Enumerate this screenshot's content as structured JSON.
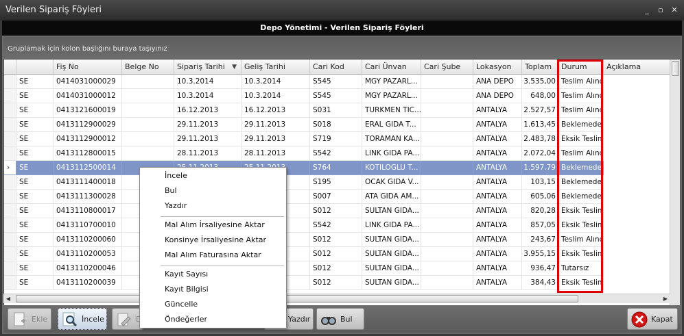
{
  "window": {
    "title": "Verilen Sipariş Föyleri",
    "minimize": "_",
    "maximize": "▫",
    "close": "✕"
  },
  "band_title": "Depo Yönetimi - Verilen Sipariş Föyleri",
  "group_hint": "Gruplamak için kolon başlığını buraya taşıyınız",
  "columns": [
    "",
    "Fiş No",
    "Belge No",
    "Sipariş Tarihi",
    "Geliş Tarihi",
    "Cari Kod",
    "Cari Ünvan",
    "Cari Şube",
    "Lokasyon",
    "Toplam",
    "Durum",
    "Açıklama"
  ],
  "sort_indicator": "▼",
  "rows": [
    {
      "t": "SE",
      "fis": "0414031000029",
      "belge": "",
      "sip": "10.3.2014",
      "gel": "10.3.2014",
      "kod": "S545",
      "unvan": "MGY PAZARL...",
      "sube": "",
      "lok": "ANA DEPO",
      "top": "3.535,00",
      "dur": "Teslim Alındı",
      "acik": ""
    },
    {
      "t": "SE",
      "fis": "0414031000012",
      "belge": "",
      "sip": "10.3.2014",
      "gel": "10.3.2014",
      "kod": "S545",
      "unvan": "MGY PAZARL...",
      "sube": "",
      "lok": "ANA DEPO",
      "top": "648,00",
      "dur": "Teslim Alındı",
      "acik": ""
    },
    {
      "t": "SE",
      "fis": "0413121600019",
      "belge": "",
      "sip": "16.12.2013",
      "gel": "16.12.2013",
      "kod": "S031",
      "unvan": "TURKMEN TIC...",
      "sube": "",
      "lok": "ANTALYA",
      "top": "2.527,57",
      "dur": "Teslim Alındı",
      "acik": ""
    },
    {
      "t": "SE",
      "fis": "0413112900029",
      "belge": "",
      "sip": "29.11.2013",
      "gel": "29.11.2013",
      "kod": "S018",
      "unvan": "ERAL GIDA T...",
      "sube": "",
      "lok": "ANTALYA",
      "top": "1.613,45",
      "dur": "Beklemede",
      "acik": ""
    },
    {
      "t": "SE",
      "fis": "0413112900012",
      "belge": "",
      "sip": "29.11.2013",
      "gel": "29.11.2013",
      "kod": "S719",
      "unvan": "TORAMAN KA...",
      "sube": "",
      "lok": "ANTALYA",
      "top": "2.483,78",
      "dur": "Eksik Teslim",
      "acik": ""
    },
    {
      "t": "SE",
      "fis": "0413112800015",
      "belge": "",
      "sip": "28.11.2013",
      "gel": "28.11.2013",
      "kod": "S542",
      "unvan": "LINK GIDA PA...",
      "sube": "",
      "lok": "ANTALYA",
      "top": "2.072,04",
      "dur": "Teslim Alındı",
      "acik": ""
    },
    {
      "t": "SE",
      "fis": "0413112500014",
      "belge": "",
      "sip": "25.11.2013",
      "gel": "25.11.2013",
      "kod": "S764",
      "unvan": "KOTILOGLU T...",
      "sube": "",
      "lok": "ANTALYA",
      "top": "1.597,79",
      "dur": "Beklemede",
      "acik": ""
    },
    {
      "t": "SE",
      "fis": "0413111400018",
      "belge": "",
      "sip": "",
      "gel": "",
      "kod": "S195",
      "unvan": "OCAK GIDA V...",
      "sube": "",
      "lok": "ANTALYA",
      "top": "103,15",
      "dur": "Beklemede",
      "acik": ""
    },
    {
      "t": "SE",
      "fis": "0413111300028",
      "belge": "",
      "sip": "",
      "gel": "",
      "kod": "S007",
      "unvan": "ATA GIDA AM...",
      "sube": "",
      "lok": "ANTALYA",
      "top": "605,06",
      "dur": "Beklemede",
      "acik": ""
    },
    {
      "t": "SE",
      "fis": "0413110800017",
      "belge": "",
      "sip": "",
      "gel": "",
      "kod": "S012",
      "unvan": "SULTAN GIDA...",
      "sube": "",
      "lok": "ANTALYA",
      "top": "820,28",
      "dur": "Eksik Teslim",
      "acik": ""
    },
    {
      "t": "SE",
      "fis": "0413110700010",
      "belge": "",
      "sip": "",
      "gel": "",
      "kod": "S542",
      "unvan": "LINK GIDA PA...",
      "sube": "",
      "lok": "ANTALYA",
      "top": "857,05",
      "dur": "Eksik Teslim",
      "acik": ""
    },
    {
      "t": "SE",
      "fis": "0413110200060",
      "belge": "",
      "sip": "",
      "gel": "",
      "kod": "S012",
      "unvan": "SULTAN GIDA...",
      "sube": "",
      "lok": "ANTALYA",
      "top": "243,67",
      "dur": "Teslim Alındı",
      "acik": ""
    },
    {
      "t": "SE",
      "fis": "0413110200053",
      "belge": "",
      "sip": "",
      "gel": "",
      "kod": "S012",
      "unvan": "SULTAN GIDA...",
      "sube": "",
      "lok": "ANTALYA",
      "top": "3.955,15",
      "dur": "Eksik Teslim",
      "acik": ""
    },
    {
      "t": "SE",
      "fis": "0413110200046",
      "belge": "",
      "sip": "",
      "gel": "",
      "kod": "S012",
      "unvan": "SULTAN GIDA...",
      "sube": "",
      "lok": "ANTALYA",
      "top": "936,47",
      "dur": "Tutarsız",
      "acik": ""
    },
    {
      "t": "SE",
      "fis": "0413110200039",
      "belge": "",
      "sip": "",
      "gel": "",
      "kod": "S012",
      "unvan": "SULTAN GIDA...",
      "sube": "",
      "lok": "ANTALYA",
      "top": "384,43",
      "dur": "Eksik Teslim",
      "acik": ""
    }
  ],
  "selected_row": 6,
  "row_indicator": "›",
  "context_menu": {
    "groups": [
      [
        "İncele",
        "Bul",
        "Yazdır"
      ],
      [
        "Mal Alım İrsaliyesine Aktar",
        "Konsinye İrsaliyesine Aktar",
        "Mal Alım Faturasına Aktar"
      ],
      [
        "Kayıt Sayısı",
        "Kayıt Bilgisi",
        "Güncelle",
        "Öndeğerler"
      ]
    ]
  },
  "toolbar": {
    "ekle": "Ekle",
    "incele": "İncele",
    "degistir": "De",
    "yazdir": "Yazdır",
    "bul": "Bul",
    "kapat": "Kapat"
  },
  "colors": {
    "selection": "#7f95c8",
    "highlight_box": "#e00000",
    "band": "#0a0a0a"
  }
}
